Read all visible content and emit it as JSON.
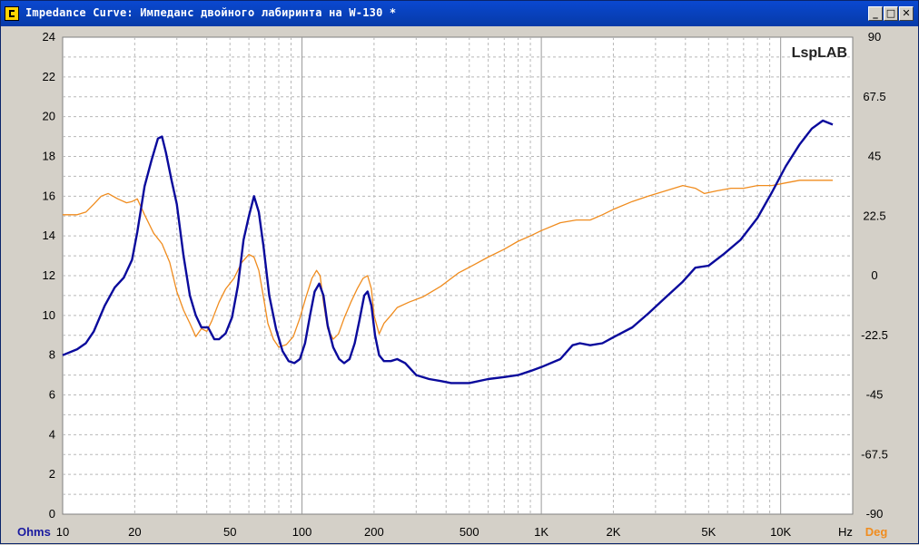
{
  "window": {
    "title": "Impedance Curve: Импеданс двойного лабиринта  на W-130 *",
    "minimize_glyph": "_",
    "maximize_glyph": "□",
    "close_glyph": "✕"
  },
  "watermark": "LspLAB",
  "colors": {
    "impedance": "#0a0a9c",
    "phase": "#f08c1e",
    "grid": "#b8b8b8",
    "plot_bg": "#ffffff",
    "axis_left_label": "#1a1aa0",
    "axis_right_label": "#f08c1e"
  },
  "chart_data": {
    "type": "line",
    "title": "Impedance Curve: Импеданс двойного лабиринта  на W-130 *",
    "xlabel": "Hz",
    "ylabel": "Ohms",
    "y2label": "Deg",
    "x_scale": "log",
    "xlim": [
      10,
      20000
    ],
    "ylim": [
      0,
      24
    ],
    "y2lim": [
      -90,
      90
    ],
    "grid": true,
    "x_ticks": [
      {
        "value": 10,
        "label": "10"
      },
      {
        "value": 20,
        "label": "20"
      },
      {
        "value": 50,
        "label": "50"
      },
      {
        "value": 100,
        "label": "100"
      },
      {
        "value": 200,
        "label": "200"
      },
      {
        "value": 500,
        "label": "500"
      },
      {
        "value": 1000,
        "label": "1K"
      },
      {
        "value": 2000,
        "label": "2K"
      },
      {
        "value": 5000,
        "label": "5K"
      },
      {
        "value": 10000,
        "label": "10K"
      }
    ],
    "y_ticks": [
      0,
      2,
      4,
      6,
      8,
      10,
      12,
      14,
      16,
      18,
      20,
      22,
      24
    ],
    "y2_ticks": [
      -90,
      -67.5,
      -45,
      -22.5,
      0,
      22.5,
      45,
      67.5,
      90
    ],
    "series": [
      {
        "axis": "left",
        "points": [
          [
            10,
            8.0
          ],
          [
            11.5,
            8.3
          ],
          [
            12.5,
            8.6
          ],
          [
            13.5,
            9.2
          ],
          [
            15,
            10.5
          ],
          [
            16.5,
            11.4
          ],
          [
            18,
            11.9
          ],
          [
            19.5,
            12.8
          ],
          [
            20.5,
            14.2
          ],
          [
            22,
            16.5
          ],
          [
            23.5,
            17.8
          ],
          [
            25,
            18.9
          ],
          [
            26,
            19.0
          ],
          [
            27,
            18.2
          ],
          [
            28.5,
            16.8
          ],
          [
            30,
            15.6
          ],
          [
            32,
            13.0
          ],
          [
            34,
            11.0
          ],
          [
            36,
            10.0
          ],
          [
            38,
            9.4
          ],
          [
            40.5,
            9.4
          ],
          [
            43,
            8.8
          ],
          [
            45,
            8.8
          ],
          [
            48,
            9.1
          ],
          [
            51,
            9.9
          ],
          [
            54,
            11.5
          ],
          [
            57,
            13.8
          ],
          [
            60,
            15.0
          ],
          [
            63,
            16.0
          ],
          [
            66,
            15.2
          ],
          [
            69,
            13.5
          ],
          [
            73,
            11.0
          ],
          [
            78,
            9.3
          ],
          [
            83,
            8.2
          ],
          [
            88,
            7.7
          ],
          [
            93,
            7.6
          ],
          [
            98,
            7.8
          ],
          [
            103,
            8.6
          ],
          [
            108,
            10.0
          ],
          [
            113,
            11.2
          ],
          [
            118,
            11.6
          ],
          [
            123,
            11.0
          ],
          [
            128,
            9.5
          ],
          [
            135,
            8.4
          ],
          [
            143,
            7.8
          ],
          [
            150,
            7.6
          ],
          [
            158,
            7.8
          ],
          [
            166,
            8.6
          ],
          [
            174,
            9.8
          ],
          [
            182,
            11.0
          ],
          [
            188,
            11.2
          ],
          [
            195,
            10.5
          ],
          [
            202,
            9.0
          ],
          [
            210,
            8.0
          ],
          [
            220,
            7.7
          ],
          [
            235,
            7.7
          ],
          [
            250,
            7.8
          ],
          [
            270,
            7.6
          ],
          [
            300,
            7.0
          ],
          [
            340,
            6.8
          ],
          [
            380,
            6.7
          ],
          [
            420,
            6.6
          ],
          [
            500,
            6.6
          ],
          [
            600,
            6.8
          ],
          [
            700,
            6.9
          ],
          [
            800,
            7.0
          ],
          [
            900,
            7.2
          ],
          [
            1000,
            7.4
          ],
          [
            1200,
            7.8
          ],
          [
            1350,
            8.5
          ],
          [
            1450,
            8.6
          ],
          [
            1600,
            8.5
          ],
          [
            1800,
            8.6
          ],
          [
            2000,
            8.9
          ],
          [
            2400,
            9.4
          ],
          [
            2800,
            10.1
          ],
          [
            3300,
            10.9
          ],
          [
            3900,
            11.7
          ],
          [
            4400,
            12.4
          ],
          [
            5000,
            12.5
          ],
          [
            5800,
            13.1
          ],
          [
            6800,
            13.8
          ],
          [
            8000,
            14.9
          ],
          [
            9200,
            16.2
          ],
          [
            10500,
            17.5
          ],
          [
            12000,
            18.6
          ],
          [
            13500,
            19.4
          ],
          [
            15000,
            19.8
          ],
          [
            16500,
            19.6
          ]
        ]
      },
      {
        "axis": "right",
        "points": [
          [
            10,
            23
          ],
          [
            11.5,
            23
          ],
          [
            12.5,
            24
          ],
          [
            13.5,
            27
          ],
          [
            14.5,
            30
          ],
          [
            15.5,
            31
          ],
          [
            17,
            29
          ],
          [
            18.5,
            27.5
          ],
          [
            19.5,
            28
          ],
          [
            20.5,
            29
          ],
          [
            22,
            23
          ],
          [
            24,
            16
          ],
          [
            26,
            12
          ],
          [
            28,
            5
          ],
          [
            30,
            -6
          ],
          [
            32,
            -13
          ],
          [
            34,
            -18
          ],
          [
            36,
            -23
          ],
          [
            38,
            -20
          ],
          [
            40,
            -21
          ],
          [
            42,
            -17
          ],
          [
            45,
            -10
          ],
          [
            48,
            -5
          ],
          [
            52,
            -1
          ],
          [
            56,
            5
          ],
          [
            60,
            8
          ],
          [
            63,
            7
          ],
          [
            66,
            2
          ],
          [
            69,
            -8
          ],
          [
            72,
            -18
          ],
          [
            76,
            -24
          ],
          [
            80,
            -27
          ],
          [
            86,
            -26
          ],
          [
            92,
            -23
          ],
          [
            98,
            -16
          ],
          [
            104,
            -8
          ],
          [
            110,
            -1
          ],
          [
            115,
            2
          ],
          [
            119,
            0
          ],
          [
            123,
            -10
          ],
          [
            128,
            -20
          ],
          [
            135,
            -24
          ],
          [
            142,
            -22
          ],
          [
            150,
            -16
          ],
          [
            160,
            -10
          ],
          [
            170,
            -5
          ],
          [
            180,
            -1
          ],
          [
            188,
            0
          ],
          [
            195,
            -5
          ],
          [
            200,
            -15
          ],
          [
            210,
            -22
          ],
          [
            220,
            -18
          ],
          [
            235,
            -15
          ],
          [
            250,
            -12
          ],
          [
            280,
            -10
          ],
          [
            320,
            -8
          ],
          [
            380,
            -4
          ],
          [
            450,
            1
          ],
          [
            520,
            4
          ],
          [
            600,
            7
          ],
          [
            700,
            10
          ],
          [
            800,
            13
          ],
          [
            900,
            15
          ],
          [
            1000,
            17
          ],
          [
            1200,
            20
          ],
          [
            1400,
            21
          ],
          [
            1600,
            21
          ],
          [
            1800,
            23
          ],
          [
            2000,
            25
          ],
          [
            2400,
            28
          ],
          [
            2800,
            30
          ],
          [
            3300,
            32
          ],
          [
            3900,
            34
          ],
          [
            4400,
            33
          ],
          [
            4800,
            31
          ],
          [
            5400,
            32
          ],
          [
            6200,
            33
          ],
          [
            7000,
            33
          ],
          [
            8000,
            34
          ],
          [
            9200,
            34
          ],
          [
            10500,
            35
          ],
          [
            12000,
            36
          ],
          [
            14000,
            36
          ],
          [
            16500,
            36
          ]
        ]
      }
    ]
  }
}
